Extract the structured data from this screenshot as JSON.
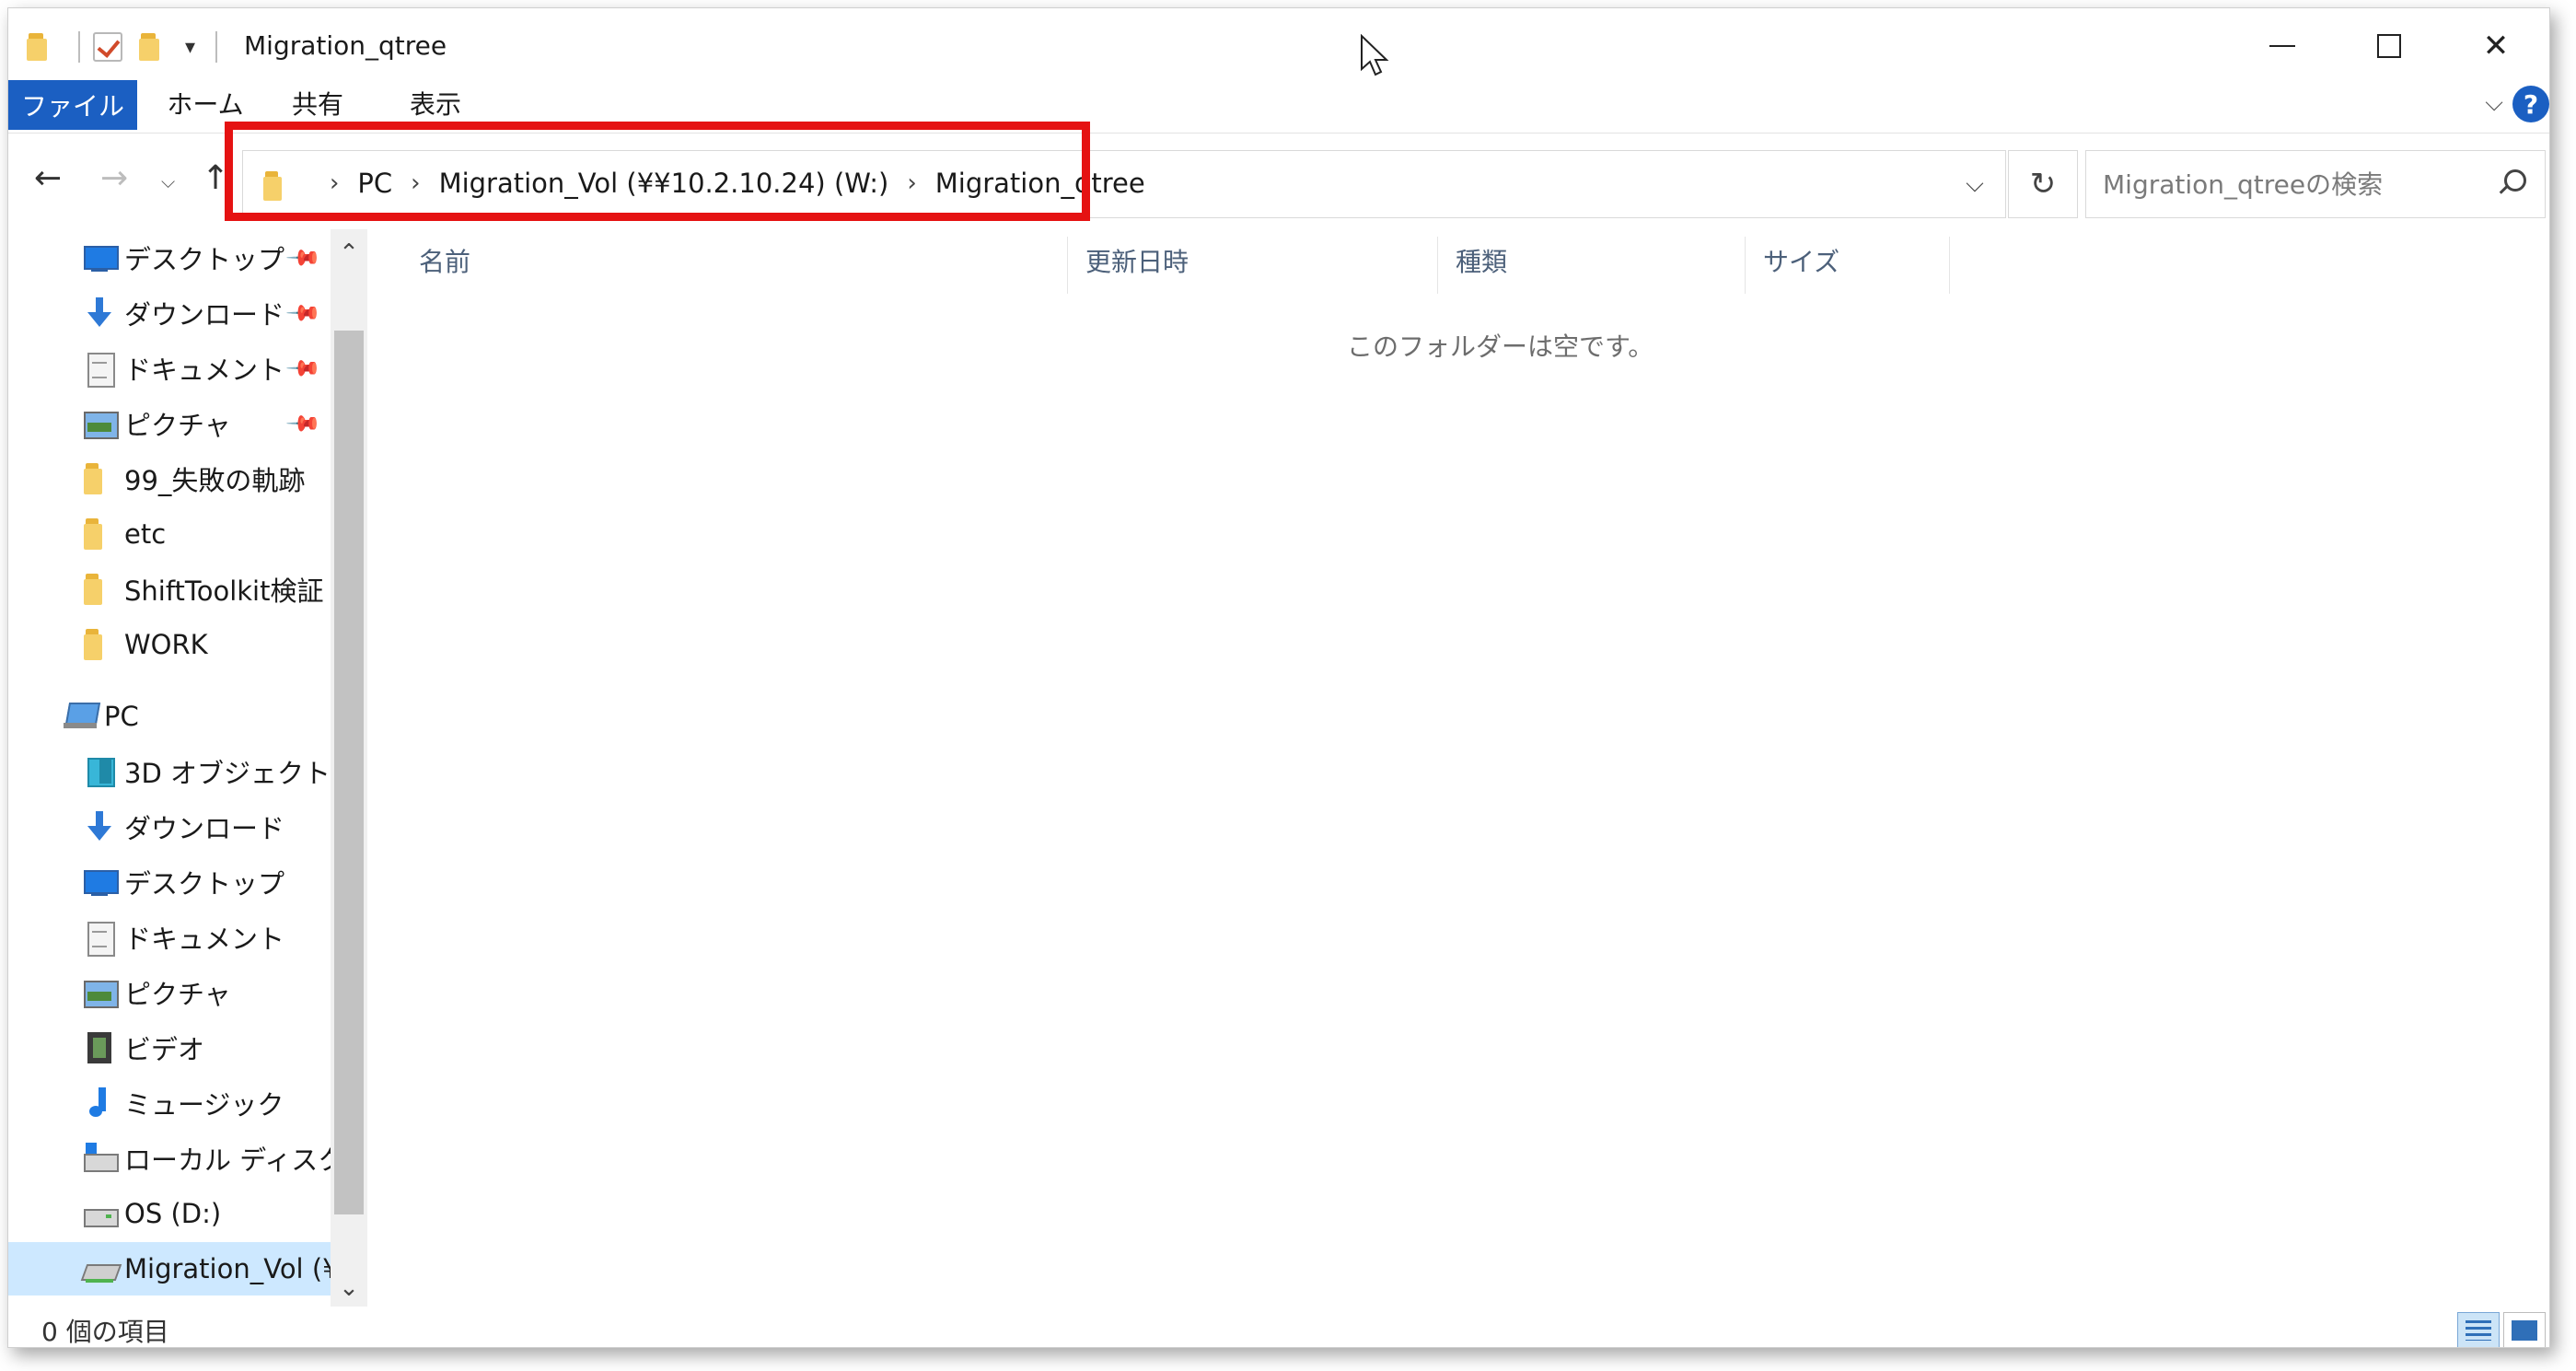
{
  "window": {
    "title": "Migration_qtree"
  },
  "ribbon": {
    "tabs": [
      "ファイル",
      "ホーム",
      "共有",
      "表示"
    ]
  },
  "address": {
    "crumbs": [
      "PC",
      "Migration_Vol (¥¥10.2.10.24) (W:)",
      "Migration_qtree"
    ]
  },
  "search": {
    "placeholder": "Migration_qtreeの検索"
  },
  "navpane": {
    "quick_access": [
      {
        "label": "デスクトップ",
        "icon": "desktop-icon",
        "pinned": true
      },
      {
        "label": "ダウンロード",
        "icon": "download-icon",
        "pinned": true
      },
      {
        "label": "ドキュメント",
        "icon": "document-icon",
        "pinned": true
      },
      {
        "label": "ピクチャ",
        "icon": "picture-icon",
        "pinned": true
      },
      {
        "label": "99_失敗の軌跡",
        "icon": "folder-icon",
        "pinned": false
      },
      {
        "label": "etc",
        "icon": "folder-icon",
        "pinned": false
      },
      {
        "label": "ShiftToolkit検証",
        "icon": "folder-icon",
        "pinned": false
      },
      {
        "label": "WORK",
        "icon": "folder-icon",
        "pinned": false
      }
    ],
    "pc_label": "PC",
    "pc_items": [
      {
        "label": "3D オブジェクト",
        "icon": "3d-objects-icon"
      },
      {
        "label": "ダウンロード",
        "icon": "download-icon"
      },
      {
        "label": "デスクトップ",
        "icon": "desktop-icon"
      },
      {
        "label": "ドキュメント",
        "icon": "document-icon"
      },
      {
        "label": "ピクチャ",
        "icon": "picture-icon"
      },
      {
        "label": "ビデオ",
        "icon": "video-icon"
      },
      {
        "label": "ミュージック",
        "icon": "music-icon"
      },
      {
        "label": "ローカル ディスク (C",
        "icon": "windows-drive-icon"
      },
      {
        "label": "OS (D:)",
        "icon": "drive-icon"
      },
      {
        "label": "Migration_Vol (¥¥",
        "icon": "network-drive-icon",
        "selected": true
      }
    ]
  },
  "content": {
    "columns": [
      "名前",
      "更新日時",
      "種類",
      "サイズ"
    ],
    "empty_message": "このフォルダーは空です。"
  },
  "status": {
    "item_count": "0 個の項目"
  },
  "colors": {
    "file_tab": "#1b5fc2",
    "highlight": "#e51212",
    "selected_row": "#cde8ff"
  }
}
